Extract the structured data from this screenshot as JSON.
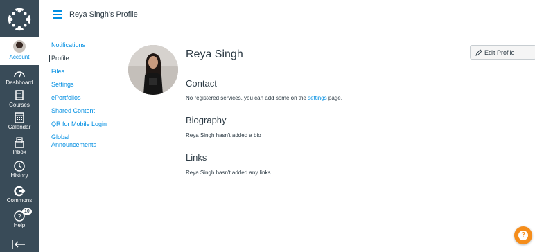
{
  "header": {
    "breadcrumb": "Reya Singh's Profile"
  },
  "global_nav": {
    "items": [
      {
        "label": "Account",
        "icon": "avatar"
      },
      {
        "label": "Dashboard",
        "icon": "dashboard-icon"
      },
      {
        "label": "Courses",
        "icon": "courses-icon"
      },
      {
        "label": "Calendar",
        "icon": "calendar-icon"
      },
      {
        "label": "Inbox",
        "icon": "inbox-icon"
      },
      {
        "label": "History",
        "icon": "history-icon"
      },
      {
        "label": "Commons",
        "icon": "commons-icon"
      },
      {
        "label": "Help",
        "icon": "help-icon",
        "badge": "10"
      }
    ]
  },
  "profile_nav": {
    "items": [
      {
        "label": "Notifications"
      },
      {
        "label": "Profile"
      },
      {
        "label": "Files"
      },
      {
        "label": "Settings"
      },
      {
        "label": "ePortfolios"
      },
      {
        "label": "Shared Content"
      },
      {
        "label": "QR for Mobile Login"
      },
      {
        "label": "Global Announcements"
      }
    ]
  },
  "profile": {
    "name": "Reya Singh",
    "edit_label": "Edit Profile",
    "contact_heading": "Contact",
    "contact_text_before": "No registered services, you can add some on the ",
    "contact_link": "settings",
    "contact_text_after": " page.",
    "bio_heading": "Biography",
    "bio_text": "Reya Singh hasn't added a bio",
    "links_heading": "Links",
    "links_text": "Reya Singh hasn't added any links"
  },
  "colors": {
    "nav_bg": "#394b58",
    "link": "#008ee2",
    "help_fab": "#f58d1b"
  }
}
